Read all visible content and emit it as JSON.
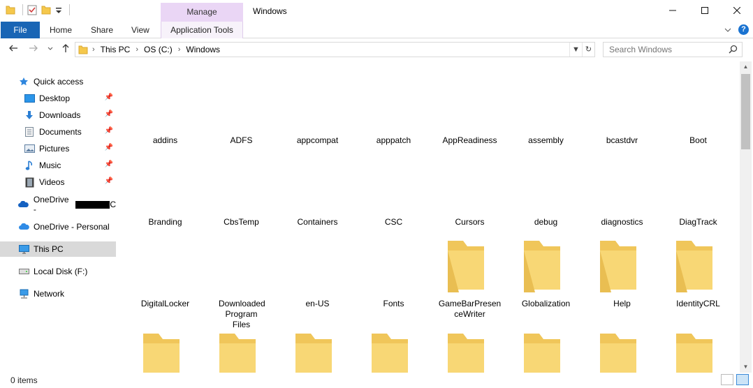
{
  "window": {
    "title": "Windows",
    "contextual_tab": "Manage",
    "contextual_group": "Application Tools"
  },
  "ribbon": {
    "tabs": [
      "File",
      "Home",
      "Share",
      "View"
    ]
  },
  "address": {
    "crumbs": [
      "This PC",
      "OS (C:)",
      "Windows"
    ]
  },
  "search": {
    "placeholder": "Search Windows"
  },
  "sidebar": {
    "quick_access": "Quick access",
    "items": [
      {
        "label": "Desktop",
        "icon": "desktop-icon"
      },
      {
        "label": "Downloads",
        "icon": "downloads-icon"
      },
      {
        "label": "Documents",
        "icon": "documents-icon"
      },
      {
        "label": "Pictures",
        "icon": "pictures-icon"
      },
      {
        "label": "Music",
        "icon": "music-icon"
      },
      {
        "label": "Videos",
        "icon": "videos-icon"
      }
    ],
    "onedrive_business": "OneDrive -",
    "onedrive_business_suffix": "C",
    "onedrive_personal": "OneDrive - Personal",
    "this_pc": "This PC",
    "local_disk": "Local Disk (F:)",
    "network": "Network"
  },
  "folders": {
    "row1": [
      "addins",
      "ADFS",
      "appcompat",
      "apppatch",
      "AppReadiness",
      "assembly",
      "bcastdvr",
      "Boot"
    ],
    "row2": [
      "Branding",
      "CbsTemp",
      "Containers",
      "CSC",
      "Cursors",
      "debug",
      "diagnostics",
      "DiagTrack"
    ],
    "row3": [
      "DigitalLocker",
      "Downloaded Program Files",
      "en-US",
      "Fonts",
      "GameBarPresenceWriter",
      "Globalization",
      "Help",
      "IdentityCRL"
    ]
  },
  "status": {
    "items": "0 items"
  },
  "colors": {
    "file_tab": "#1965b5",
    "manage_tab": "#ead6f5",
    "folder": "#f8d775"
  }
}
